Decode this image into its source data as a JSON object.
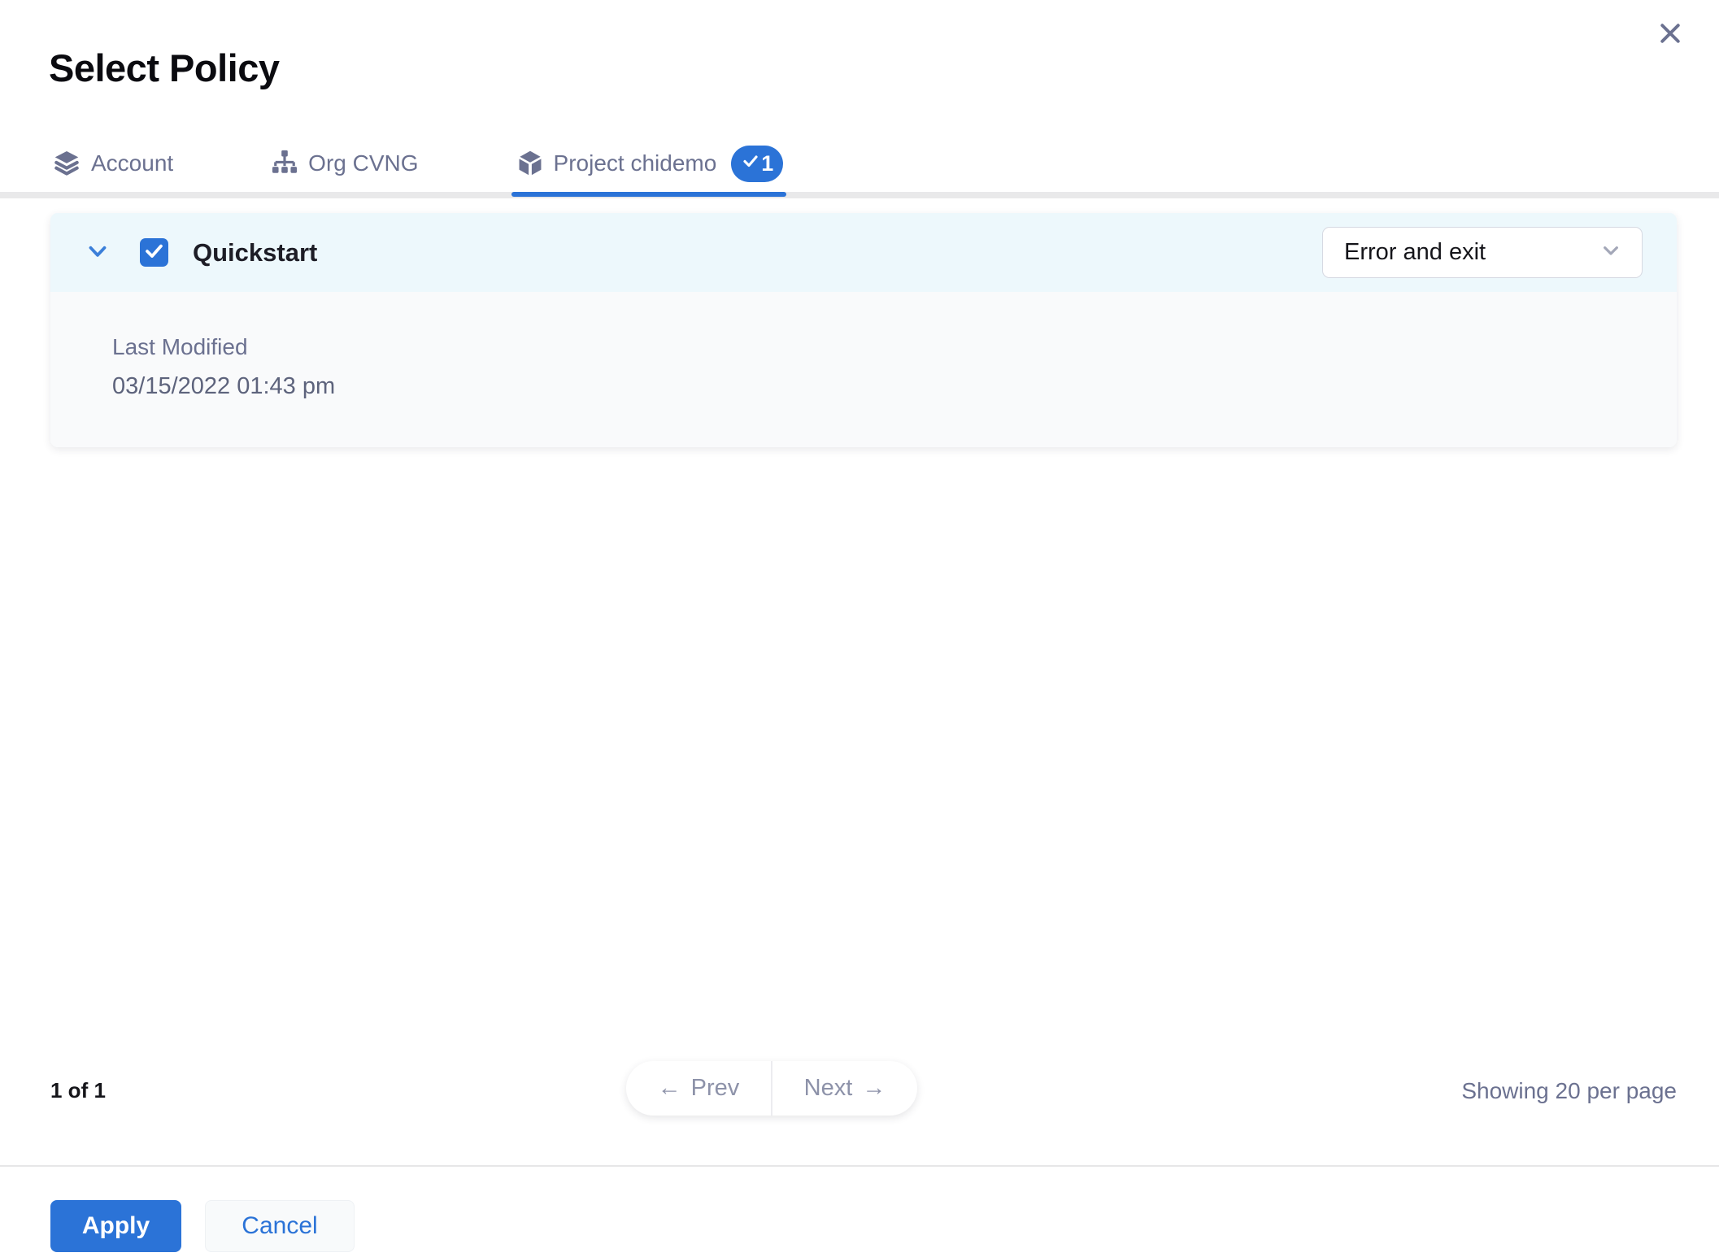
{
  "dialog": {
    "title": "Select Policy"
  },
  "tabs": [
    {
      "label": "Account",
      "icon": "layers-icon",
      "active": false
    },
    {
      "label": "Org CVNG",
      "icon": "hierarchy-icon",
      "active": false
    },
    {
      "label": "Project chidemo",
      "icon": "cube-icon",
      "active": true,
      "badge_count": "1"
    }
  ],
  "policies": [
    {
      "name": "Quickstart",
      "selected": true,
      "on_failure_action": "Error and exit",
      "last_modified_label": "Last Modified",
      "last_modified": "03/15/2022 01:43 pm"
    }
  ],
  "pagination": {
    "page_status": "1 of 1",
    "prev_arrow": "←",
    "prev_label": "Prev",
    "next_label": "Next",
    "next_arrow": "→",
    "showing_text": "Showing 20 per page"
  },
  "footer": {
    "apply_label": "Apply",
    "cancel_label": "Cancel"
  },
  "icons": {
    "close": "x-icon",
    "account_tab": "layers-icon",
    "org_tab": "hierarchy-icon",
    "project_tab": "cube-icon",
    "badge": "check-icon",
    "expand": "chevron-down-icon",
    "checkbox": "check-icon",
    "dropdown": "chevron-down-icon"
  },
  "colors": {
    "primary_blue": "#2b73d7",
    "tab_text_gray": "#6b7190",
    "card_header_bg": "#edf8fc",
    "card_body_bg": "#f9fafb",
    "muted_text": "#8d92a9"
  }
}
